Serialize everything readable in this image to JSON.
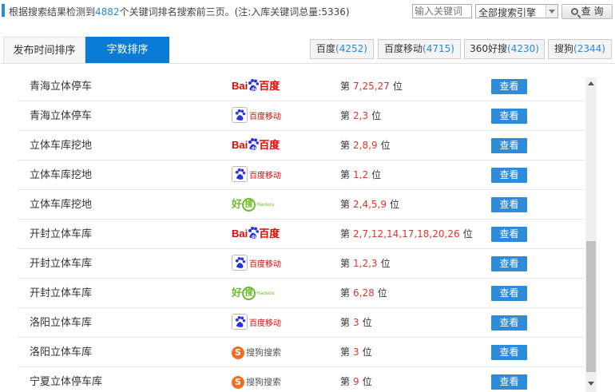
{
  "info": {
    "prefix": "根据搜索结果检测到",
    "count": "4882",
    "suffix": "个关键词排名搜索前三页。(注:入库关键词总量:5336)"
  },
  "search": {
    "placeholder": "输入关键词",
    "engine_selected": "全部搜索引擎",
    "button_label": "查 询"
  },
  "tabs": [
    {
      "label": "发布时间排序",
      "active": false
    },
    {
      "label": "字数排序",
      "active": true
    }
  ],
  "engines": [
    {
      "name": "百度",
      "count": "(4252)"
    },
    {
      "name": "百度移动",
      "count": "(4715)"
    },
    {
      "name": "360好搜",
      "count": "(4230)"
    },
    {
      "name": "搜狗",
      "count": "(2344)"
    }
  ],
  "rank_prefix": "第",
  "rank_suffix": "位",
  "view_label": "查看",
  "logos": {
    "baidu": {
      "bai": "Bai",
      "du": "百度"
    },
    "baidu_mobile": {
      "text": "百度移动"
    },
    "haosou": {
      "hao": "好",
      "sou": "搜",
      "en": "Haosou"
    },
    "sogou": {
      "s": "S",
      "text": "搜狗搜索"
    }
  },
  "rows": [
    {
      "keyword": "青海立体停车",
      "engine": "baidu",
      "positions": "7,25,27"
    },
    {
      "keyword": "青海立体停车",
      "engine": "baidu_mobile",
      "positions": "2,3"
    },
    {
      "keyword": "立体车库挖地",
      "engine": "baidu",
      "positions": "2,8,9"
    },
    {
      "keyword": "立体车库挖地",
      "engine": "baidu_mobile",
      "positions": "1,2"
    },
    {
      "keyword": "立体车库挖地",
      "engine": "haosou",
      "positions": "2,4,5,9"
    },
    {
      "keyword": "开封立体车库",
      "engine": "baidu",
      "positions": "2,7,12,14,17,18,20,26"
    },
    {
      "keyword": "开封立体车库",
      "engine": "baidu_mobile",
      "positions": "1,2,3"
    },
    {
      "keyword": "开封立体车库",
      "engine": "haosou",
      "positions": "6,28"
    },
    {
      "keyword": "洛阳立体车库",
      "engine": "baidu_mobile",
      "positions": "3"
    },
    {
      "keyword": "洛阳立体车库",
      "engine": "sogou",
      "positions": "3"
    },
    {
      "keyword": "宁夏立体停车库",
      "engine": "sogou",
      "positions": "9"
    }
  ],
  "colors": {
    "accent": "#0a7bd6",
    "button": "#2e8bd9",
    "rank": "#d9372b",
    "count": "#2b8ad6"
  }
}
